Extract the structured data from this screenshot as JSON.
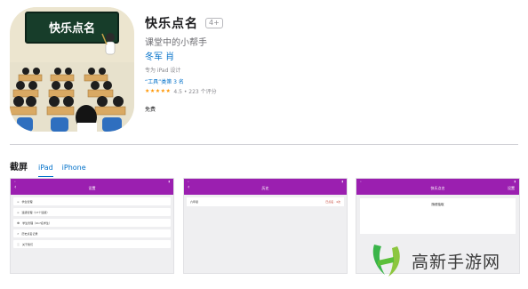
{
  "app": {
    "title": "快乐点名",
    "age_rating": "4+",
    "subtitle": "课堂中的小帮手",
    "developer": "冬军 肖",
    "designed_for": "专为 iPad 设计",
    "rank": "“工具”类第 3 名",
    "stars": "★★★★★",
    "rating_text": "4.5 • 223 个评分",
    "price": "免费",
    "icon": {
      "board_text": "快乐点名",
      "board_color": "#173d2a"
    }
  },
  "screenshots_section": {
    "title": "截屏",
    "tabs": [
      {
        "label": "iPad",
        "active": true
      },
      {
        "label": "iPhone",
        "active": false
      }
    ]
  },
  "screenshots": [
    {
      "nav_title": "设置",
      "items": [
        {
          "icon": "list-icon",
          "label": "学生管理"
        },
        {
          "icon": "list-icon",
          "label": "班级管理（17个班级）"
        },
        {
          "icon": "group-icon",
          "label": "学生管理（417名学生）"
        },
        {
          "icon": "history-icon",
          "label": "历史点名记录"
        },
        {
          "icon": "info-icon",
          "label": "关于我们"
        }
      ]
    },
    {
      "nav_title": "历史",
      "row_label": "六年级",
      "row_meta": "已点名 · 4次"
    },
    {
      "nav_title": "快乐点名",
      "nav_action": "设置",
      "button_label": "随便抽取"
    }
  ],
  "accent_color": "#9b1fb0",
  "link_color": "#0070c9",
  "watermark": {
    "text": "高新手游网",
    "logo_colors": [
      "#3ab54a",
      "#8cc63f"
    ]
  }
}
